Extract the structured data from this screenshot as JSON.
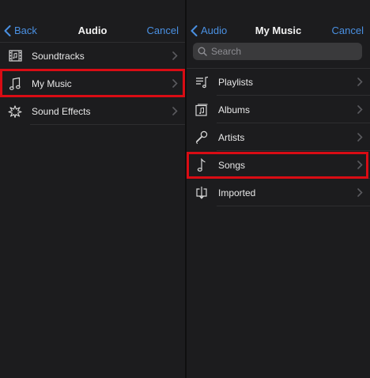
{
  "left_panel": {
    "back_label": "Back",
    "title": "Audio",
    "cancel_label": "Cancel",
    "items": [
      {
        "label": "Soundtracks",
        "icon": "film-strip-icon"
      },
      {
        "label": "My Music",
        "icon": "music-note-icon",
        "highlighted": true
      },
      {
        "label": "Sound Effects",
        "icon": "sound-burst-icon"
      }
    ]
  },
  "right_panel": {
    "back_label": "Audio",
    "title": "My Music",
    "cancel_label": "Cancel",
    "search": {
      "placeholder": "Search"
    },
    "items": [
      {
        "label": "Playlists",
        "icon": "playlist-icon"
      },
      {
        "label": "Albums",
        "icon": "album-icon"
      },
      {
        "label": "Artists",
        "icon": "microphone-icon"
      },
      {
        "label": "Songs",
        "icon": "music-note-icon",
        "highlighted": true
      },
      {
        "label": "Imported",
        "icon": "import-icon"
      }
    ]
  },
  "colors": {
    "accent": "#4a90e2",
    "highlight": "#d90c14",
    "background": "#1c1c1e"
  }
}
